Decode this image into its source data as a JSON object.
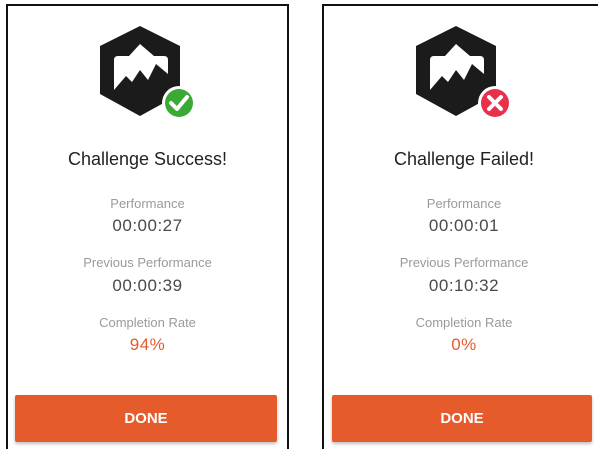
{
  "colors": {
    "accent": "#e55b2c",
    "success": "#3aaa35",
    "failure": "#e8304a",
    "badge": "#1b1b1b"
  },
  "success_screen": {
    "badge_icon": "mountain-badge-icon",
    "status_icon": "check-circle-icon",
    "title": "Challenge Success!",
    "performance_label": "Performance",
    "performance_value": "00:00:27",
    "previous_label": "Previous Performance",
    "previous_value": "00:00:39",
    "completion_label": "Completion Rate",
    "completion_value": "94%",
    "done_label": "DONE"
  },
  "failure_screen": {
    "badge_icon": "mountain-badge-icon",
    "status_icon": "x-circle-icon",
    "title": "Challenge Failed!",
    "performance_label": "Performance",
    "performance_value": "00:00:01",
    "previous_label": "Previous Performance",
    "previous_value": "00:10:32",
    "completion_label": "Completion Rate",
    "completion_value": "0%",
    "done_label": "DONE"
  }
}
